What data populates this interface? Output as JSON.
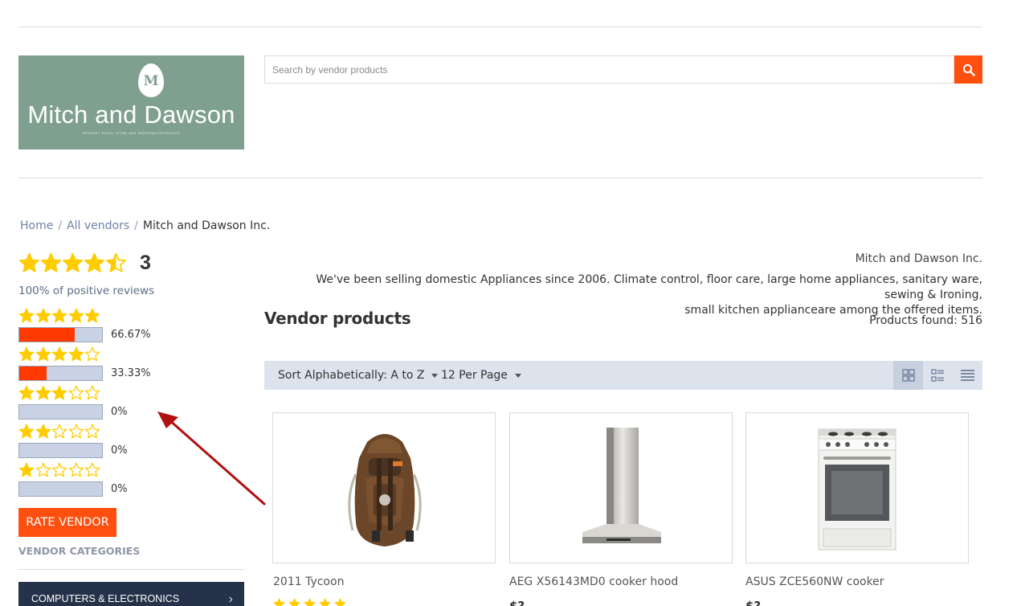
{
  "logo": {
    "initial": "M",
    "brand": "Mitch and Dawson",
    "tagline": "INTERNET RETAIL STORE AND SHOPPING EXPERIENCE"
  },
  "search": {
    "placeholder": "Search by vendor products",
    "value": "",
    "icon": "search-icon"
  },
  "breadcrumb": {
    "home": "Home",
    "sep": "/",
    "vendors": "All vendors",
    "current": "Mitch and Dawson Inc."
  },
  "rating": {
    "average_stars": 4.5,
    "count": "3",
    "positive": "100% of positive reviews",
    "breakdown": [
      {
        "stars": 5,
        "pct": "66.67%",
        "fraction": 0.6667
      },
      {
        "stars": 4,
        "pct": "33.33%",
        "fraction": 0.3333
      },
      {
        "stars": 3,
        "pct": "0%",
        "fraction": 0
      },
      {
        "stars": 2,
        "pct": "0%",
        "fraction": 0
      },
      {
        "stars": 1,
        "pct": "0%",
        "fraction": 0
      }
    ],
    "rate_button": "RATE VENDOR"
  },
  "categories": {
    "title": "VENDOR CATEGORIES",
    "items": [
      {
        "label": "COMPUTERS & ELECTRONICS",
        "icon": "chevron-right-icon"
      }
    ]
  },
  "vendor": {
    "name": "Mitch and Dawson Inc.",
    "description_line1": "We've been selling domestic Appliances since 2006. Climate control, floor care, large home appliances, sanitary ware, sewing & Ironing,",
    "description_line2": "small kitchen applianceare among the offered items."
  },
  "products_section": {
    "title": "Vendor products",
    "found": "Products found: 516",
    "sort": "Sort Alphabetically: A to Z",
    "per_page": "12 Per Page",
    "views": [
      "grid-view-icon",
      "list-view-icon",
      "compact-list-icon"
    ],
    "active_view": "grid-view-icon"
  },
  "products": [
    {
      "title": "2011 Tycoon",
      "rating": 5,
      "price": "$?",
      "image": "backpack"
    },
    {
      "title": "AEG X56143MD0 cooker hood",
      "rating": 0,
      "price": "$?",
      "image": "cooker-hood"
    },
    {
      "title": "ASUS ZCE560NW cooker",
      "rating": 0,
      "price": "$?",
      "image": "electric-cooker"
    }
  ],
  "colors": {
    "accent": "#ff4f0f",
    "star": "#ffcc00",
    "toolbar": "#dde3ed",
    "category_bg": "#253249",
    "logo_bg": "#7fa08f",
    "annotation_arrow": "#b01010"
  }
}
